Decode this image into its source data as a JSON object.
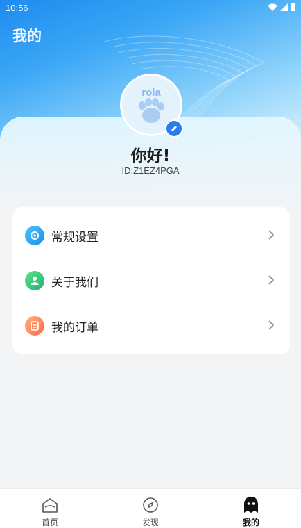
{
  "status_bar": {
    "time": "10:56"
  },
  "header": {
    "title": "我的"
  },
  "profile": {
    "avatar_text": "rola",
    "greeting": "你好!",
    "user_id": "ID:Z1EZ4PGA"
  },
  "menu": {
    "items": [
      {
        "label": "常规设置",
        "icon": "settings-icon",
        "color": "#1aa3ef"
      },
      {
        "label": "关于我们",
        "icon": "people-icon",
        "color": "#2fc27a"
      },
      {
        "label": "我的订单",
        "icon": "order-icon",
        "color": "#ff7f55"
      }
    ]
  },
  "tabs": [
    {
      "label": "首页",
      "icon": "home-icon"
    },
    {
      "label": "发现",
      "icon": "compass-icon"
    },
    {
      "label": "我的",
      "icon": "profile-icon"
    }
  ],
  "colors": {
    "accent": "#2b7de9",
    "header_gradient_start": "#1e8bf0",
    "background": "#f3f4f6"
  }
}
